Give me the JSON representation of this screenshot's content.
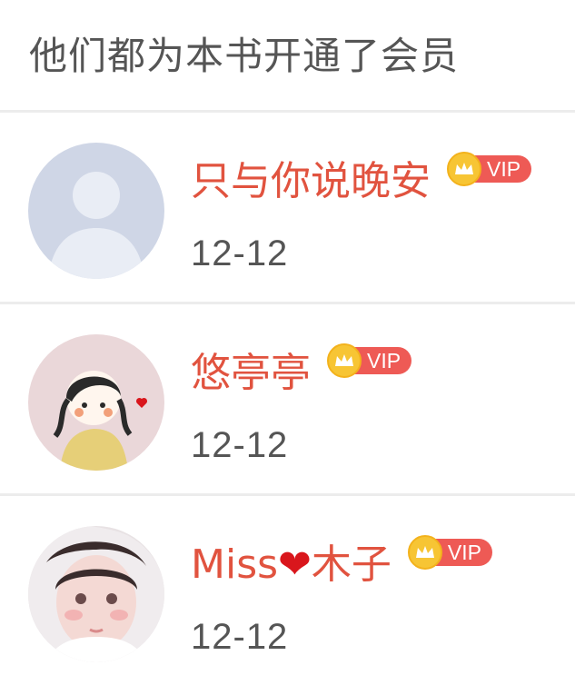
{
  "header": {
    "title": "他们都为本书开通了会员"
  },
  "members": [
    {
      "name": "只与你说晚安",
      "vip_label": "VIP",
      "date": "12-12"
    },
    {
      "name_prefix": "Miss",
      "name_emoji": "❤",
      "name_suffix": "木子",
      "vip_label": "VIP",
      "date": "12-12",
      "placeholder": true
    },
    {
      "name": "悠亭亭",
      "vip_label": "VIP",
      "date": "12-12"
    }
  ],
  "list": [
    {
      "name": "只与你说晚安",
      "vip_label": "VIP",
      "date": "12-12"
    },
    {
      "name": "悠亭亭",
      "vip_label": "VIP",
      "date": "12-12"
    },
    {
      "name_prefix": "Miss",
      "name_emoji": "❤",
      "name_suffix": "木子",
      "vip_label": "VIP",
      "date": "12-12"
    }
  ],
  "colors": {
    "name": "#e1533f",
    "vip_tag": "#ee5a55",
    "crown_badge": "#f7c534"
  }
}
